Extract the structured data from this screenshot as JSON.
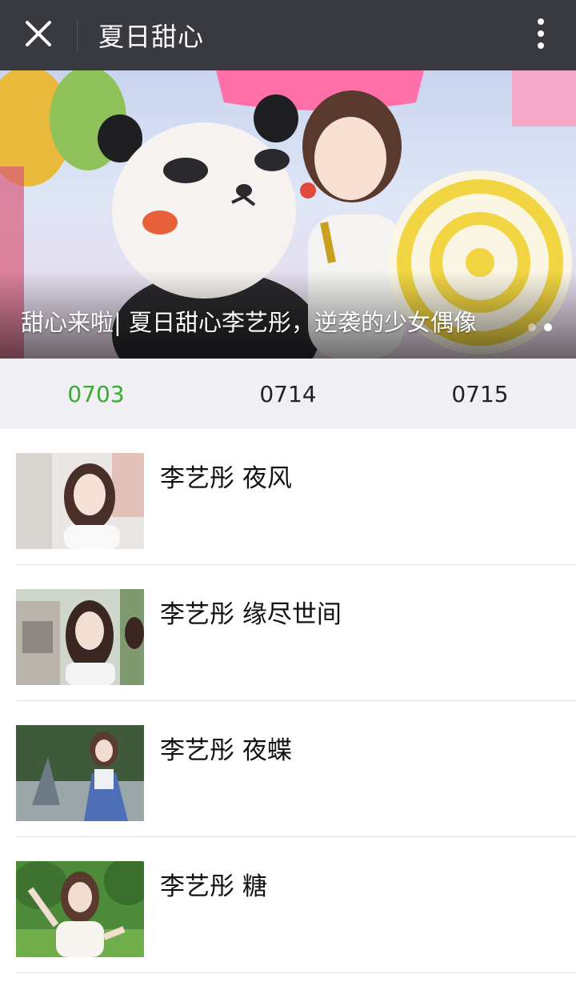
{
  "header": {
    "title": "夏日甜心",
    "close_icon": "close-icon",
    "more_icon": "more-vertical-icon",
    "background": "#393a3f"
  },
  "banner": {
    "caption": "甜心来啦| 夏日甜心李艺彤，逆袭的少女偶像",
    "slide_count": 2,
    "active_slide": 2
  },
  "tabs": [
    {
      "label": "0703",
      "active": true
    },
    {
      "label": "0714",
      "active": false
    },
    {
      "label": "0715",
      "active": false
    }
  ],
  "accent_color": "#3aa935",
  "list": {
    "items": [
      {
        "title": "李艺彤 夜风"
      },
      {
        "title": "李艺彤 缘尽世间"
      },
      {
        "title": "李艺彤 夜蝶"
      },
      {
        "title": "李艺彤 糖"
      }
    ]
  }
}
